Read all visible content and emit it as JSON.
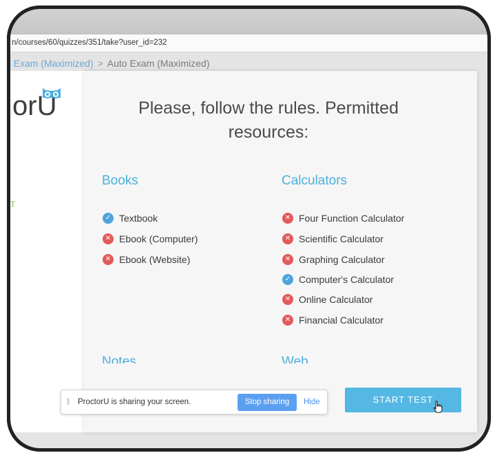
{
  "browser": {
    "url": "n/courses/60/quizzes/351/take?user_id=232"
  },
  "breadcrumb": {
    "link": "o Exam (Maximized)",
    "separator": ">",
    "current": "Auto Exam (Maximized)"
  },
  "sidebar": {
    "logo_text": "orU",
    "side_letter": "T"
  },
  "modal": {
    "title": "Please, follow the rules. Permitted resources:",
    "columns": {
      "books": {
        "heading": "Books",
        "items": [
          {
            "label": "Textbook",
            "allowed": true
          },
          {
            "label": "Ebook (Computer)",
            "allowed": false
          },
          {
            "label": "Ebook (Website)",
            "allowed": false
          }
        ]
      },
      "calculators": {
        "heading": "Calculators",
        "items": [
          {
            "label": "Four Function Calculator",
            "allowed": false
          },
          {
            "label": "Scientific Calculator",
            "allowed": false
          },
          {
            "label": "Graphing Calculator",
            "allowed": false
          },
          {
            "label": "Computer's Calculator",
            "allowed": true
          },
          {
            "label": "Online Calculator",
            "allowed": false
          },
          {
            "label": "Financial Calculator",
            "allowed": false
          }
        ]
      },
      "notes_heading": "Notes",
      "web_heading": "Web"
    },
    "start_button": "START TEST"
  },
  "share_bar": {
    "grip": "||",
    "message": "ProctorU is sharing your screen.",
    "stop_label": "Stop sharing",
    "hide_label": "Hide"
  },
  "colors": {
    "accent": "#4ab0de",
    "allowed": "#4ea4dc",
    "denied": "#e35a5a",
    "start_button": "#55b8e4",
    "stop_button": "#5b9ff0"
  },
  "icons": {
    "allowed": "check-circle-icon",
    "denied": "x-circle-icon"
  }
}
